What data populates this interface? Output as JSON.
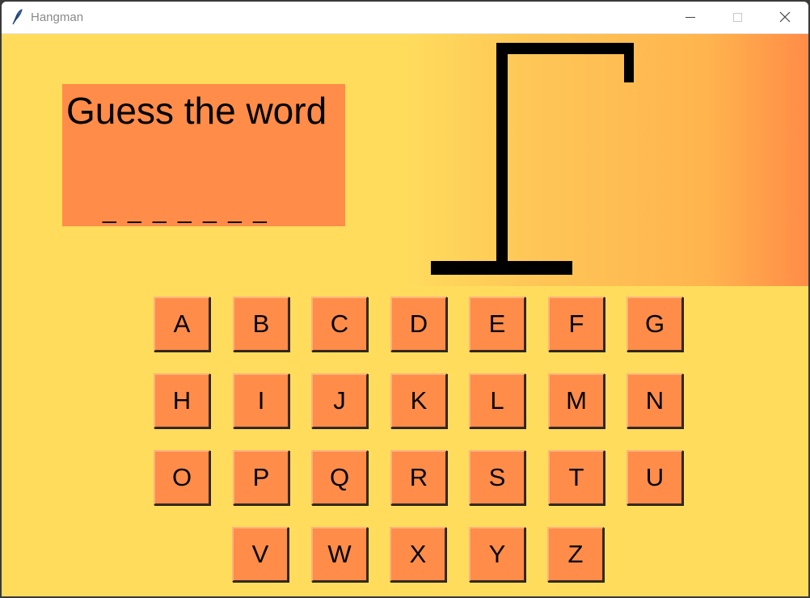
{
  "window": {
    "title": "Hangman"
  },
  "word_panel": {
    "title": "Guess the word",
    "blanks": "_ _ _ _ _ _ _"
  },
  "letters": {
    "row1": [
      "A",
      "B",
      "C",
      "D",
      "E",
      "F",
      "G"
    ],
    "row2": [
      "H",
      "I",
      "J",
      "K",
      "L",
      "M",
      "N"
    ],
    "row3": [
      "O",
      "P",
      "Q",
      "R",
      "S",
      "T",
      "U"
    ],
    "row4": [
      "V",
      "W",
      "X",
      "Y",
      "Z"
    ]
  },
  "colors": {
    "background": "#ffdc5c",
    "accent": "#ff8c49",
    "gallows": "#000000"
  },
  "icons": {
    "app": "feather-icon",
    "minimize": "minimize-icon",
    "maximize": "maximize-icon",
    "close": "close-icon"
  }
}
